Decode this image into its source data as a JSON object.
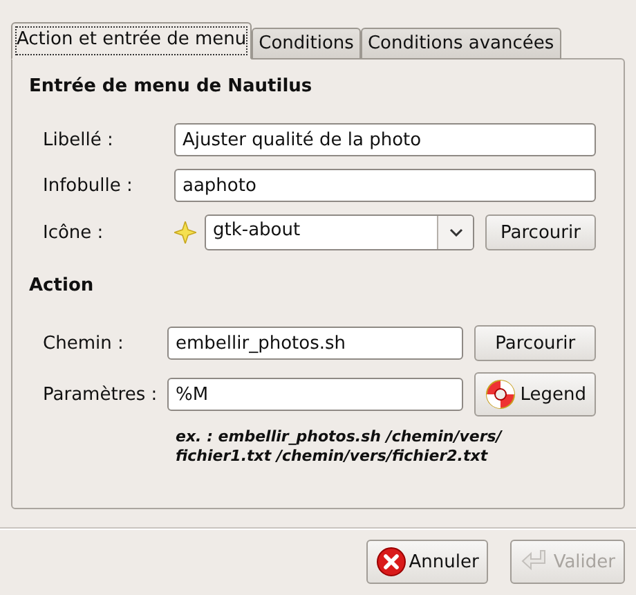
{
  "tabs": [
    {
      "label": "Action et entrée de menu",
      "selected": true
    },
    {
      "label": "Conditions",
      "selected": false
    },
    {
      "label": "Conditions avancées",
      "selected": false
    }
  ],
  "sections": [
    {
      "title": "Entrée de menu de Nautilus",
      "rows": [
        {
          "kind": "text",
          "label": "Libellé :",
          "value": "Ajuster qualité de la photo"
        },
        {
          "kind": "text",
          "label": "Infobulle :",
          "value": "aaphoto"
        },
        {
          "kind": "combo",
          "label": "Icône :",
          "value": "gtk-about",
          "button": {
            "label": "Parcourir",
            "kind": "plain"
          }
        }
      ]
    },
    {
      "title": "Action",
      "rows": [
        {
          "kind": "text",
          "label": "Chemin :",
          "value": "embellir_photos.sh",
          "button": {
            "label": "Parcourir",
            "kind": "plain"
          }
        },
        {
          "kind": "text",
          "label": "Paramètres :",
          "value": "%M",
          "button": {
            "label": "Legend",
            "kind": "help"
          }
        }
      ],
      "hint": "ex. : embellir_photos.sh /chemin/vers/ fichier1.txt /chemin/vers/fichier2.txt"
    }
  ],
  "buttons": [
    {
      "label": "Annuler",
      "kind": "cancel",
      "disabled": false
    },
    {
      "label": "Valider",
      "kind": "ok",
      "disabled": true
    }
  ]
}
